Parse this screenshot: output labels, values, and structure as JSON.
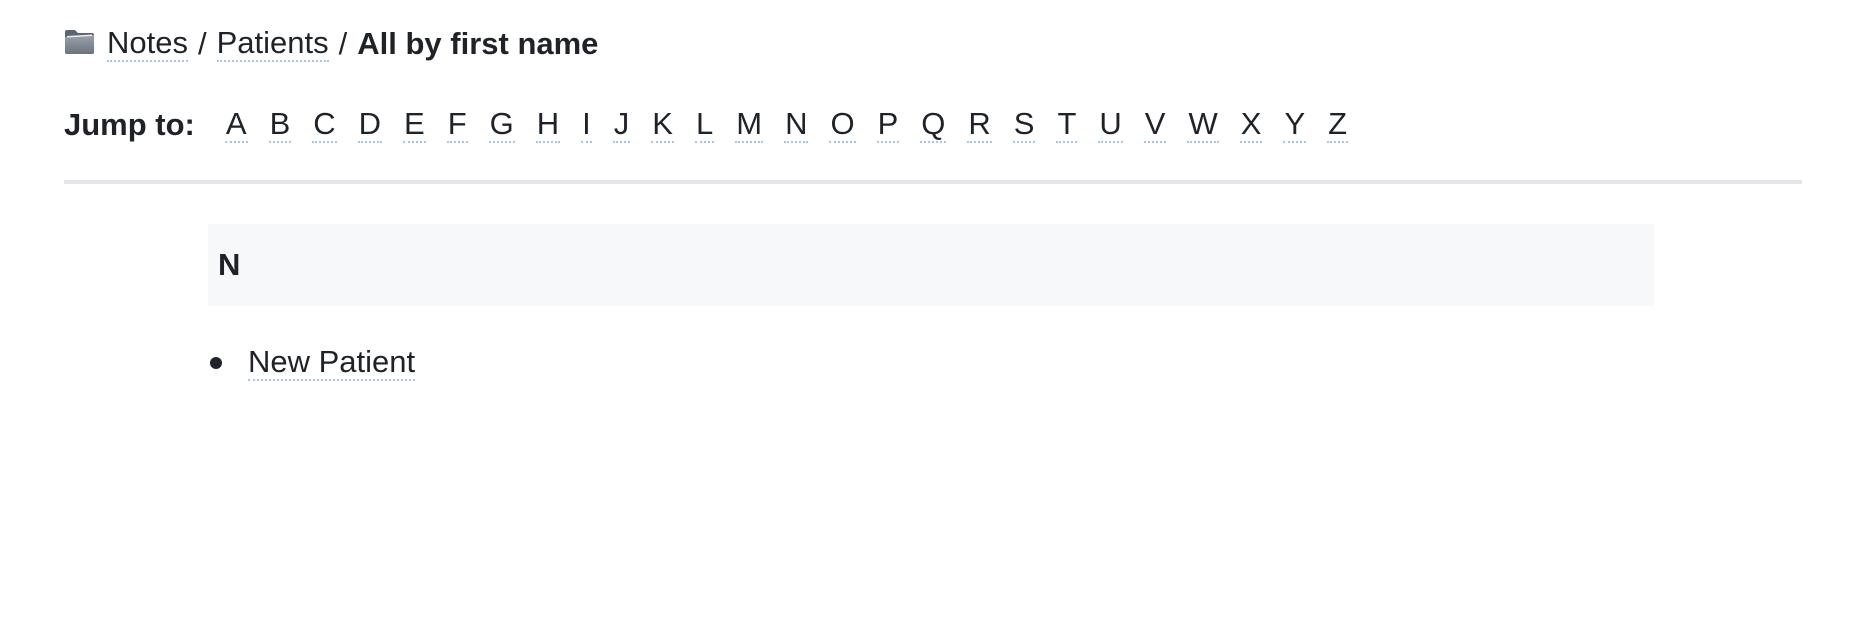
{
  "breadcrumb": {
    "icon": "folder-icon",
    "items": [
      "Notes",
      "Patients"
    ],
    "separator": "/",
    "current": "All by first name"
  },
  "jump": {
    "label": "Jump to:",
    "letters": [
      "A",
      "B",
      "C",
      "D",
      "E",
      "F",
      "G",
      "H",
      "I",
      "J",
      "K",
      "L",
      "M",
      "N",
      "O",
      "P",
      "Q",
      "R",
      "S",
      "T",
      "U",
      "V",
      "W",
      "X",
      "Y",
      "Z"
    ]
  },
  "groups": [
    {
      "letter": "N",
      "notes": [
        "New Patient"
      ]
    }
  ],
  "colors": {
    "text": "#1f2328",
    "link_underline": "#a7c6e8",
    "divider": "#e3e7ec",
    "section_bg": "#f6f8fa"
  }
}
